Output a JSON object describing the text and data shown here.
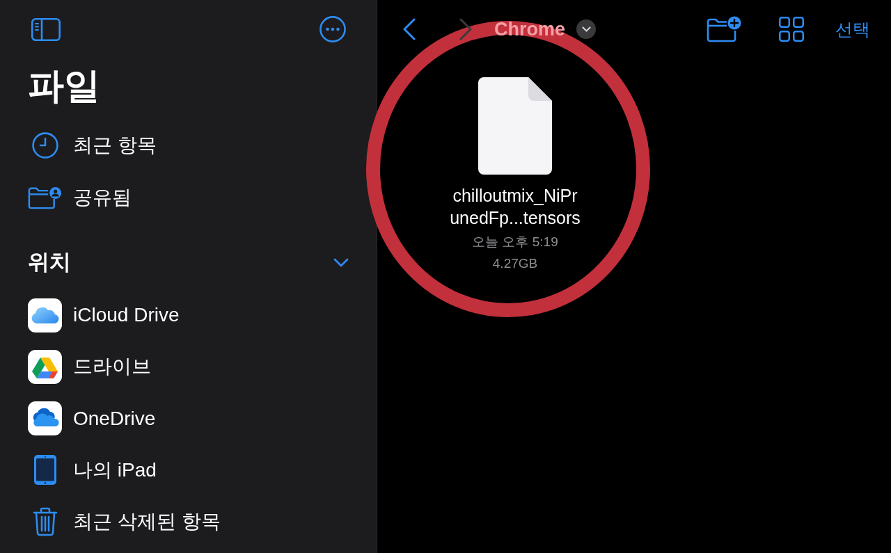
{
  "sidebar": {
    "title": "파일",
    "favorites": [
      {
        "kind": "recents",
        "label": "최근 항목"
      },
      {
        "kind": "shared",
        "label": "공유됨"
      }
    ],
    "locations": {
      "title": "위치",
      "expanded": true,
      "items": [
        {
          "kind": "icloud",
          "label": "iCloud Drive"
        },
        {
          "kind": "gdrive",
          "label": "드라이브"
        },
        {
          "kind": "onedrive",
          "label": "OneDrive"
        },
        {
          "kind": "ipad",
          "label": "나의 iPad"
        },
        {
          "kind": "trash",
          "label": "최근 삭제된 항목"
        }
      ]
    }
  },
  "toolbar": {
    "back": {
      "disabled": false
    },
    "forward": {
      "disabled": true
    },
    "title": "Chrome",
    "select_label": "선택"
  },
  "files": [
    {
      "name": "chilloutmix_NiPrunedFp...tensors",
      "date": "오늘 오후 5:19",
      "size": "4.27GB"
    }
  ],
  "annotation": {
    "kind": "ring"
  }
}
